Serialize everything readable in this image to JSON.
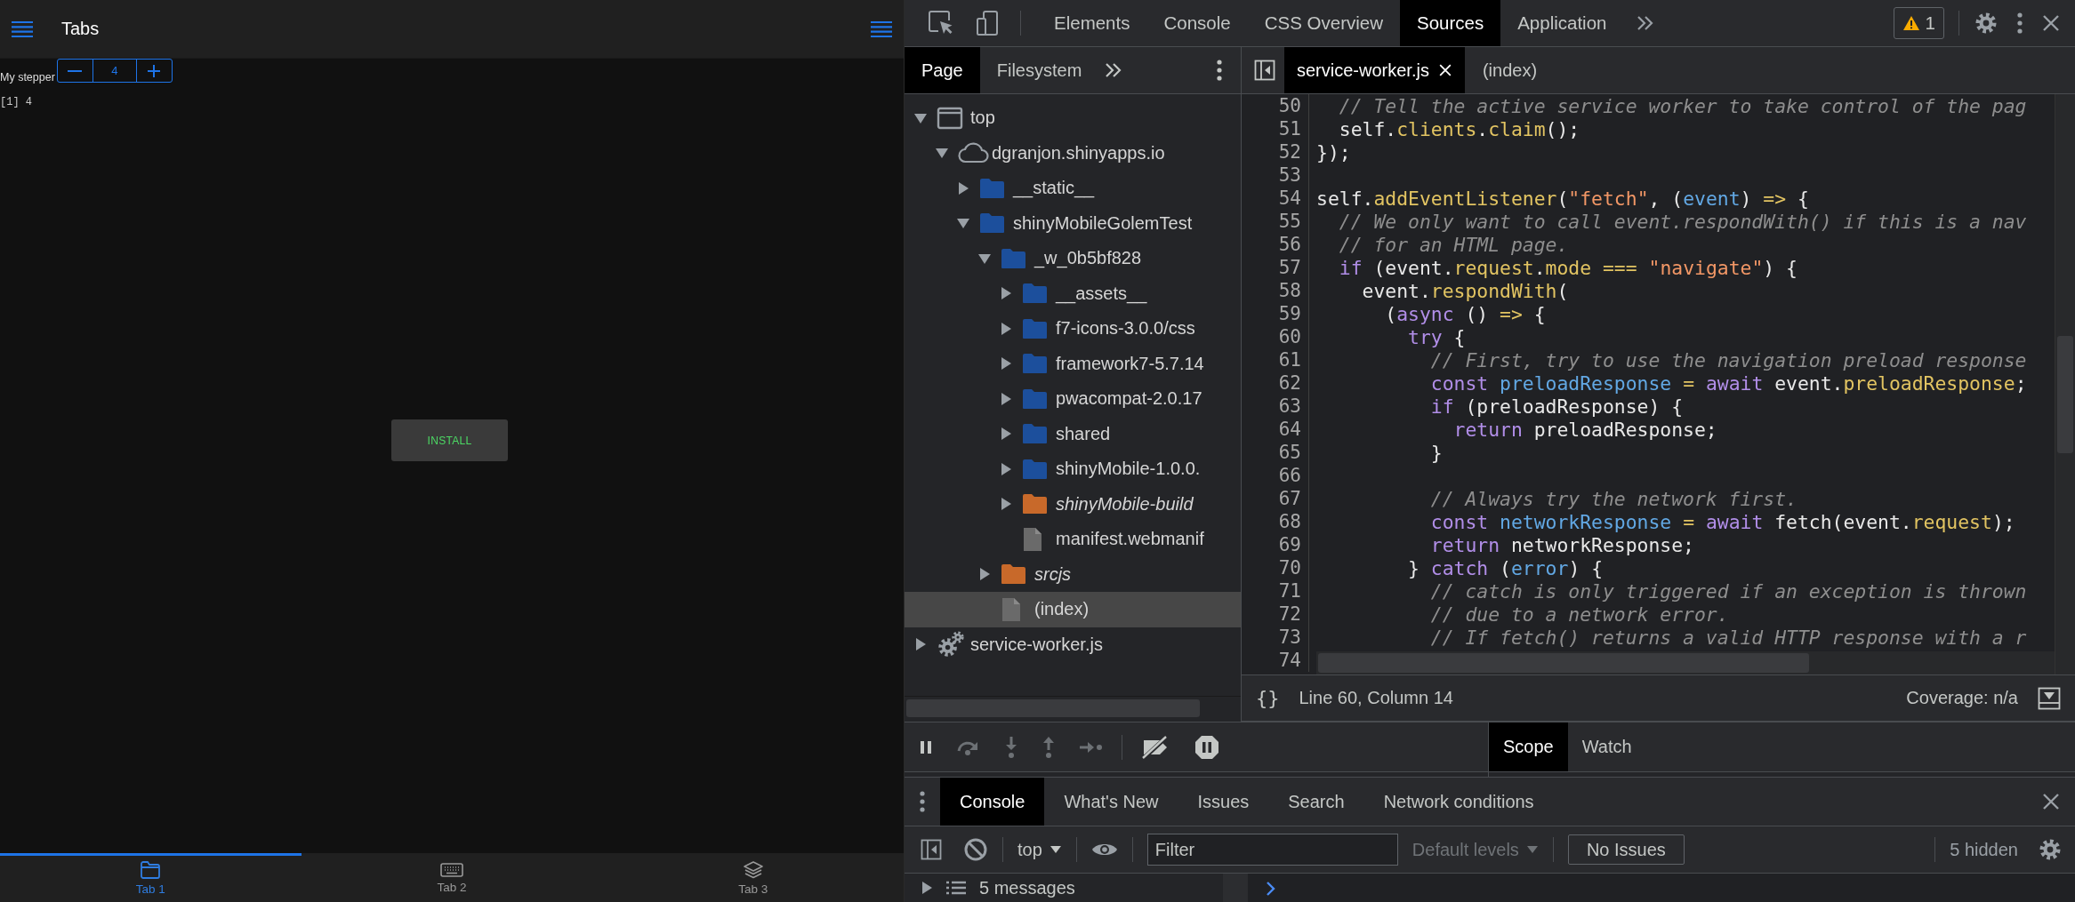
{
  "mobile_app": {
    "navbar": {
      "title": "Tabs"
    },
    "stepper": {
      "label": "My stepper",
      "value": "4"
    },
    "output": "[1] 4",
    "install_button": "INSTALL",
    "tabbar": [
      {
        "label": "Tab 1",
        "kind": "folder",
        "selected": true
      },
      {
        "label": "Tab 2",
        "kind": "keyboard",
        "selected": false
      },
      {
        "label": "Tab 3",
        "kind": "layers",
        "selected": false
      }
    ]
  },
  "devtools": {
    "main_tabs": [
      {
        "label": "Elements",
        "selected": false
      },
      {
        "label": "Console",
        "selected": false
      },
      {
        "label": "CSS Overview",
        "selected": false
      },
      {
        "label": "Sources",
        "selected": true
      },
      {
        "label": "Application",
        "selected": false
      }
    ],
    "warning_count": "1",
    "navigator": {
      "tabs": [
        {
          "label": "Page",
          "selected": true
        },
        {
          "label": "Filesystem",
          "selected": false
        }
      ],
      "tree": [
        {
          "label": "top",
          "kind": "frame",
          "expanded": true,
          "selected": false,
          "children": [
            {
              "label": "dgranjon.shinyapps.io",
              "kind": "domain",
              "expanded": true,
              "selected": false,
              "children": [
                {
                  "label": "__static__",
                  "kind": "folder",
                  "expanded": false,
                  "selected": false
                },
                {
                  "label": "shinyMobileGolemTest",
                  "kind": "folder",
                  "expanded": true,
                  "selected": false,
                  "children": [
                    {
                      "label": "_w_0b5bf828",
                      "kind": "folder",
                      "expanded": true,
                      "selected": false,
                      "children": [
                        {
                          "label": "__assets__",
                          "kind": "folder",
                          "expanded": false,
                          "selected": false
                        },
                        {
                          "label": "f7-icons-3.0.0/css",
                          "kind": "folder",
                          "expanded": false,
                          "selected": false
                        },
                        {
                          "label": "framework7-5.7.14",
                          "kind": "folder",
                          "expanded": false,
                          "selected": false
                        },
                        {
                          "label": "pwacompat-2.0.17",
                          "kind": "folder",
                          "expanded": false,
                          "selected": false
                        },
                        {
                          "label": "shared",
                          "kind": "folder",
                          "expanded": false,
                          "selected": false
                        },
                        {
                          "label": "shinyMobile-1.0.0.",
                          "kind": "folder",
                          "expanded": false,
                          "selected": false
                        },
                        {
                          "label": "shinyMobile-build",
                          "kind": "override-folder",
                          "expanded": false,
                          "selected": false
                        },
                        {
                          "label": "manifest.webmanif",
                          "kind": "file",
                          "selected": false
                        }
                      ]
                    },
                    {
                      "label": "srcjs",
                      "kind": "override-folder",
                      "expanded": false,
                      "selected": false
                    },
                    {
                      "label": "(index)",
                      "kind": "file",
                      "selected": true
                    }
                  ]
                }
              ]
            }
          ]
        },
        {
          "label": "service-worker.js",
          "kind": "worker",
          "expanded": false,
          "selected": false
        }
      ]
    },
    "editor": {
      "tabs": [
        {
          "label": "service-worker.js",
          "selected": true,
          "closable": true
        },
        {
          "label": "(index)",
          "selected": false,
          "closable": false
        }
      ],
      "lines": [
        {
          "number": "50",
          "tokens": [
            {
              "kind": "comment",
              "text": "  // Tell the active service worker to take control of the pag"
            }
          ]
        },
        {
          "number": "51",
          "tokens": [
            {
              "kind": "plain",
              "text": "  self."
            },
            {
              "kind": "property",
              "text": "clients"
            },
            {
              "kind": "plain",
              "text": "."
            },
            {
              "kind": "property",
              "text": "claim"
            },
            {
              "kind": "plain",
              "text": "();"
            }
          ]
        },
        {
          "number": "52",
          "tokens": [
            {
              "kind": "plain",
              "text": "});"
            }
          ]
        },
        {
          "number": "53"
        },
        {
          "number": "54",
          "tokens": [
            {
              "kind": "plain",
              "text": "self."
            },
            {
              "kind": "property",
              "text": "addEventListener"
            },
            {
              "kind": "plain",
              "text": "("
            },
            {
              "kind": "string",
              "text": "\"fetch\""
            },
            {
              "kind": "plain",
              "text": ", ("
            },
            {
              "kind": "variable",
              "text": "event"
            },
            {
              "kind": "plain",
              "text": ") "
            },
            {
              "kind": "operator",
              "text": "=>"
            },
            {
              "kind": "plain",
              "text": " {"
            }
          ]
        },
        {
          "number": "55",
          "tokens": [
            {
              "kind": "comment",
              "text": "  // We only want to call event.respondWith() if this is a nav"
            }
          ]
        },
        {
          "number": "56",
          "tokens": [
            {
              "kind": "comment",
              "text": "  // for an HTML page."
            }
          ]
        },
        {
          "number": "57",
          "tokens": [
            {
              "kind": "keyword",
              "text": "  if"
            },
            {
              "kind": "plain",
              "text": " (event."
            },
            {
              "kind": "property",
              "text": "request"
            },
            {
              "kind": "plain",
              "text": "."
            },
            {
              "kind": "property",
              "text": "mode"
            },
            {
              "kind": "operator",
              "text": " === "
            },
            {
              "kind": "string",
              "text": "\"navigate\""
            },
            {
              "kind": "plain",
              "text": ") {"
            }
          ]
        },
        {
          "number": "58",
          "tokens": [
            {
              "kind": "plain",
              "text": "    event."
            },
            {
              "kind": "property",
              "text": "respondWith"
            },
            {
              "kind": "plain",
              "text": "("
            }
          ]
        },
        {
          "number": "59",
          "tokens": [
            {
              "kind": "plain",
              "text": "      ("
            },
            {
              "kind": "keyword",
              "text": "async"
            },
            {
              "kind": "plain",
              "text": " () "
            },
            {
              "kind": "operator",
              "text": "=>"
            },
            {
              "kind": "plain",
              "text": " {"
            }
          ]
        },
        {
          "number": "60",
          "tokens": [
            {
              "kind": "keyword",
              "text": "        try"
            },
            {
              "kind": "plain",
              "text": " {"
            }
          ]
        },
        {
          "number": "61",
          "tokens": [
            {
              "kind": "comment",
              "text": "          // First, try to use the navigation preload response"
            }
          ]
        },
        {
          "number": "62",
          "tokens": [
            {
              "kind": "keyword",
              "text": "          const"
            },
            {
              "kind": "variable",
              "text": " preloadResponse"
            },
            {
              "kind": "operator",
              "text": " = "
            },
            {
              "kind": "keyword",
              "text": "await"
            },
            {
              "kind": "plain",
              "text": " event."
            },
            {
              "kind": "property",
              "text": "preloadResponse"
            },
            {
              "kind": "plain",
              "text": ";"
            }
          ]
        },
        {
          "number": "63",
          "tokens": [
            {
              "kind": "keyword",
              "text": "          if"
            },
            {
              "kind": "plain",
              "text": " (preloadResponse) {"
            }
          ]
        },
        {
          "number": "64",
          "tokens": [
            {
              "kind": "keyword",
              "text": "            return"
            },
            {
              "kind": "plain",
              "text": " preloadResponse;"
            }
          ]
        },
        {
          "number": "65",
          "tokens": [
            {
              "kind": "plain",
              "text": "          }"
            }
          ]
        },
        {
          "number": "66"
        },
        {
          "number": "67",
          "tokens": [
            {
              "kind": "comment",
              "text": "          // Always try the network first."
            }
          ]
        },
        {
          "number": "68",
          "tokens": [
            {
              "kind": "keyword",
              "text": "          const"
            },
            {
              "kind": "variable",
              "text": " networkResponse"
            },
            {
              "kind": "operator",
              "text": " = "
            },
            {
              "kind": "keyword",
              "text": "await"
            },
            {
              "kind": "plain",
              "text": " fetch(event."
            },
            {
              "kind": "property",
              "text": "request"
            },
            {
              "kind": "plain",
              "text": ");"
            }
          ]
        },
        {
          "number": "69",
          "tokens": [
            {
              "kind": "keyword",
              "text": "          return"
            },
            {
              "kind": "plain",
              "text": " networkResponse;"
            }
          ]
        },
        {
          "number": "70",
          "tokens": [
            {
              "kind": "plain",
              "text": "        } "
            },
            {
              "kind": "keyword",
              "text": "catch"
            },
            {
              "kind": "plain",
              "text": " ("
            },
            {
              "kind": "variable",
              "text": "error"
            },
            {
              "kind": "plain",
              "text": ") {"
            }
          ]
        },
        {
          "number": "71",
          "tokens": [
            {
              "kind": "comment",
              "text": "          // catch is only triggered if an exception is thrown"
            }
          ]
        },
        {
          "number": "72",
          "tokens": [
            {
              "kind": "comment",
              "text": "          // due to a network error."
            }
          ]
        },
        {
          "number": "73",
          "tokens": [
            {
              "kind": "comment",
              "text": "          // If fetch() returns a valid HTTP response with a r"
            }
          ]
        },
        {
          "number": "74"
        }
      ],
      "status": {
        "pretty_print": "{}",
        "position": "Line 60, Column 14",
        "coverage": "Coverage: n/a"
      }
    },
    "debugger": {
      "sidebar_tabs": [
        {
          "label": "Scope",
          "selected": true
        },
        {
          "label": "Watch",
          "selected": false
        }
      ]
    },
    "drawer": {
      "tabs": [
        {
          "label": "Console",
          "selected": true
        },
        {
          "label": "What's New",
          "selected": false
        },
        {
          "label": "Issues",
          "selected": false
        },
        {
          "label": "Search",
          "selected": false
        },
        {
          "label": "Network conditions",
          "selected": false
        }
      ],
      "toolbar": {
        "context": "top",
        "filter_placeholder": "Filter",
        "levels": "Default levels",
        "issues": "No Issues",
        "hidden": "5 hidden"
      },
      "messages": "5 messages"
    }
  }
}
